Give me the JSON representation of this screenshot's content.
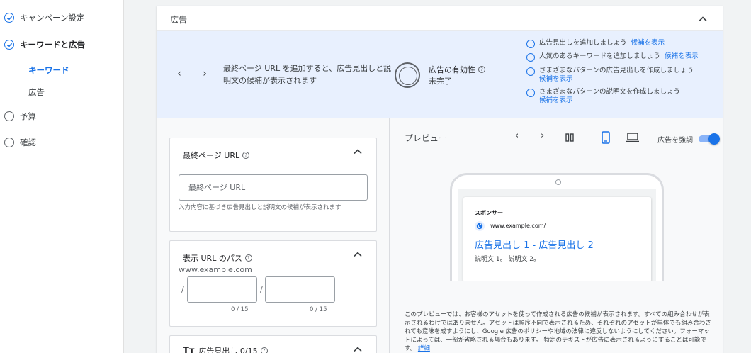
{
  "sidebar": {
    "items": [
      {
        "label": "キャンペーン設定",
        "state": "done"
      },
      {
        "label": "キーワードと広告",
        "state": "done-active"
      },
      {
        "label": "キーワード",
        "state": "sub-active"
      },
      {
        "label": "広告",
        "state": "sub"
      },
      {
        "label": "予算",
        "state": "todo"
      },
      {
        "label": "確認",
        "state": "todo"
      }
    ]
  },
  "card": {
    "title": "広告"
  },
  "banner": {
    "message": "最終ページ URL を追加すると、広告見出しと説明文の候補が表示されます",
    "effectiveness_title": "広告の有効性",
    "effectiveness_status": "未完了",
    "suggestions": [
      {
        "text": "広告見出しを追加しましょう",
        "link": "候補を表示"
      },
      {
        "text": "人気のあるキーワードを追加しましょう",
        "link": "候補を表示"
      },
      {
        "text": "さまざまなパターンの広告見出しを作成しましょう",
        "link": "候補を表示"
      },
      {
        "text": "さまざまなパターンの説明文を作成しましょう",
        "link": "候補を表示"
      }
    ]
  },
  "form": {
    "final_url": {
      "title": "最終ページ URL",
      "placeholder": "最終ページ URL",
      "hint": "入力内容に基づき広告見出しと説明文の候補が表示されます"
    },
    "display_path": {
      "title": "表示 URL のパス",
      "domain": "www.example.com",
      "slash": "/",
      "path1_counter": "0 / 15",
      "path2_counter": "0 / 15"
    },
    "headlines": {
      "title": "広告見出し 0/15"
    }
  },
  "preview": {
    "title": "プレビュー",
    "emphasize_label": "広告を強調",
    "emphasize_on": true,
    "ad": {
      "sponsor": "スポンサー",
      "domain": "www.example.com/",
      "headline": "広告見出し 1 - 広告見出し 2",
      "description": "説明文 1。 説明文 2。"
    },
    "disclaimer": "このプレビューでは、お客様のアセットを使って作成される広告の候補が表示されます。すべての組み合わせが表示されるわけではありません。アセットは順序不同で表示されるため、それぞれのアセットが単体でも組み合わされても意味を成すようにし、Google 広告のポリシーや地域の法律に違反しないようにしてください。フォーマットによっては、一部が省略される場合もあります。 特定のテキストが広告に表示されるようにすることは可能です。",
    "disclaimer_link": "詳細"
  },
  "colors": {
    "accent": "#1a73e8",
    "banner_bg": "#e8f0fe"
  }
}
